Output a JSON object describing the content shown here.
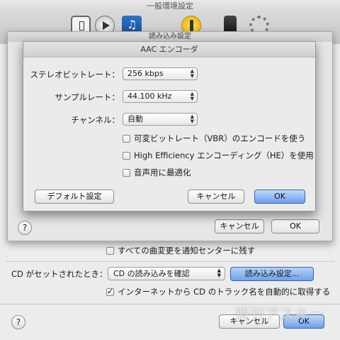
{
  "prefs": {
    "title": "一般環境設定",
    "toolbar_icons": [
      "general-icon",
      "playback-icon",
      "store-icon",
      "parental-icon",
      "devices-icon",
      "advanced-icon"
    ],
    "notify_label": "すべての曲変更を通知センターに残す",
    "notify_checked": false,
    "cd_label": "CD がセットされたとき：",
    "cd_action": "CD の読み込みを確認",
    "import_settings_button": "読み込み設定...",
    "internet_label": "インターネットから CD のトラック名を自動的に取得する",
    "internet_checked": true,
    "help_label": "?",
    "cancel_label": "キャンセル",
    "ok_label": "OK"
  },
  "import_sheet": {
    "title": "読み込み設定",
    "help_label": "?",
    "cancel_label": "キャンセル",
    "ok_label": "OK"
  },
  "aac": {
    "title": "AAC エンコーダ",
    "stereo_bitrate_label": "ステレオビットレート：",
    "stereo_bitrate_value": "256 kbps",
    "sample_rate_label": "サンプルレート：",
    "sample_rate_value": "44.100 kHz",
    "channel_label": "チャンネル：",
    "channel_value": "自動",
    "vbr_label": "可変ビットレート（VBR）のエンコードを使う",
    "vbr_checked": false,
    "he_label": "High Efficiency エンコーディング（HE）を使用",
    "he_checked": false,
    "voice_label": "音声用に最適化",
    "voice_checked": false,
    "default_button": "デフォルト設定",
    "cancel_button": "キャンセル",
    "ok_button": "OK"
  },
  "watermark": "週刊アスキー",
  "colors": {
    "accent_button": "#6ba0ea",
    "window_bg": "#ececec"
  }
}
